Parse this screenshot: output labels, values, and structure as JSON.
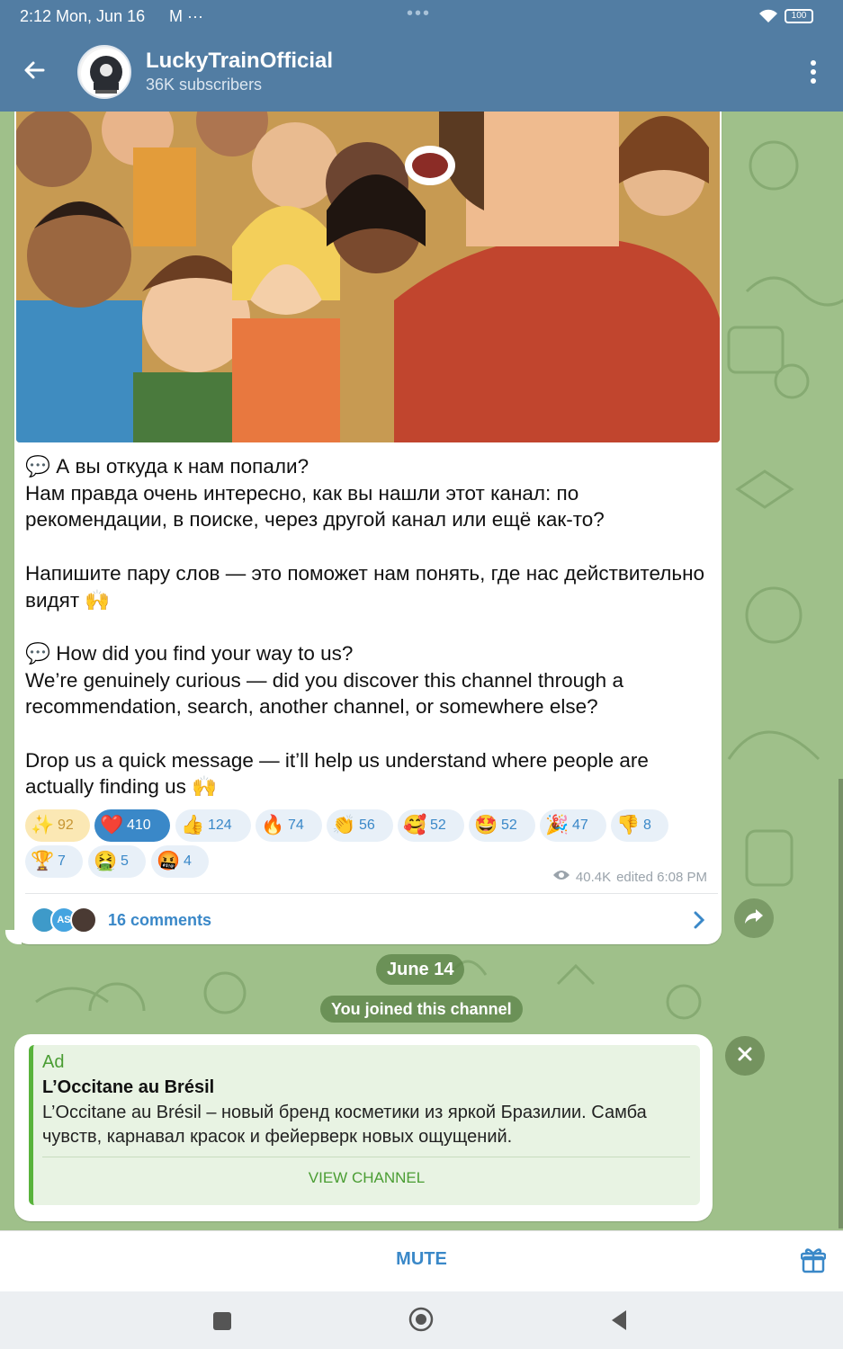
{
  "status": {
    "time": "2:12  Mon, Jun 16",
    "notif": "M ···",
    "battery": "100"
  },
  "header": {
    "title": "LuckyTrainOfficial",
    "subtitle": "36K subscribers"
  },
  "message": {
    "text": "💬 А вы откуда к нам попали?\nНам правда очень интересно, как вы нашли этот канал: по рекомендации, в поиске, через другой канал или ещё как-то?\n\nНапишите пару слов — это поможет нам понять, где нас действительно видят 🙌\n\n💬 How did you find your way to us?\nWe’re genuinely curious — did you discover this channel through a recommendation, search, another channel, or somewhere else?\n\nDrop us a quick message — it’ll help us understand where people are actually finding us 🙌",
    "reactions_row1": [
      {
        "emoji": "✨",
        "count": "92",
        "style": "gold"
      },
      {
        "emoji": "❤️",
        "count": "410",
        "style": "active"
      },
      {
        "emoji": "👍",
        "count": "124",
        "style": "normal"
      },
      {
        "emoji": "🔥",
        "count": "74",
        "style": "normal"
      },
      {
        "emoji": "👏",
        "count": "56",
        "style": "normal"
      },
      {
        "emoji": "🥰",
        "count": "52",
        "style": "normal"
      },
      {
        "emoji": "🤩",
        "count": "52",
        "style": "normal"
      },
      {
        "emoji": "🎉",
        "count": "47",
        "style": "normal"
      },
      {
        "emoji": "👎",
        "count": "8",
        "style": "normal"
      }
    ],
    "reactions_row2": [
      {
        "emoji": "🏆",
        "count": "7",
        "style": "normal"
      },
      {
        "emoji": "🤮",
        "count": "5",
        "style": "normal"
      },
      {
        "emoji": "🤬",
        "count": "4",
        "style": "normal"
      }
    ],
    "views": "40.4K",
    "edited": "edited 6:08 PM",
    "comments_label": "16 comments",
    "avatar_initials": "AS"
  },
  "service": {
    "date": "June 14",
    "joined": "You joined this channel"
  },
  "ad": {
    "tag": "Ad",
    "name": "L’Occitane au Brésil",
    "description": "L’Occitane au Brésil – новый бренд косметики из яркой Бразилии. Самба чувств, карнавал красок и фейерверк новых ощущений.",
    "button": "VIEW CHANNEL"
  },
  "bottom": {
    "mute": "MUTE"
  },
  "colors": {
    "header": "#527da3",
    "accent": "#3a88c8",
    "ad_green": "#58b33b"
  }
}
